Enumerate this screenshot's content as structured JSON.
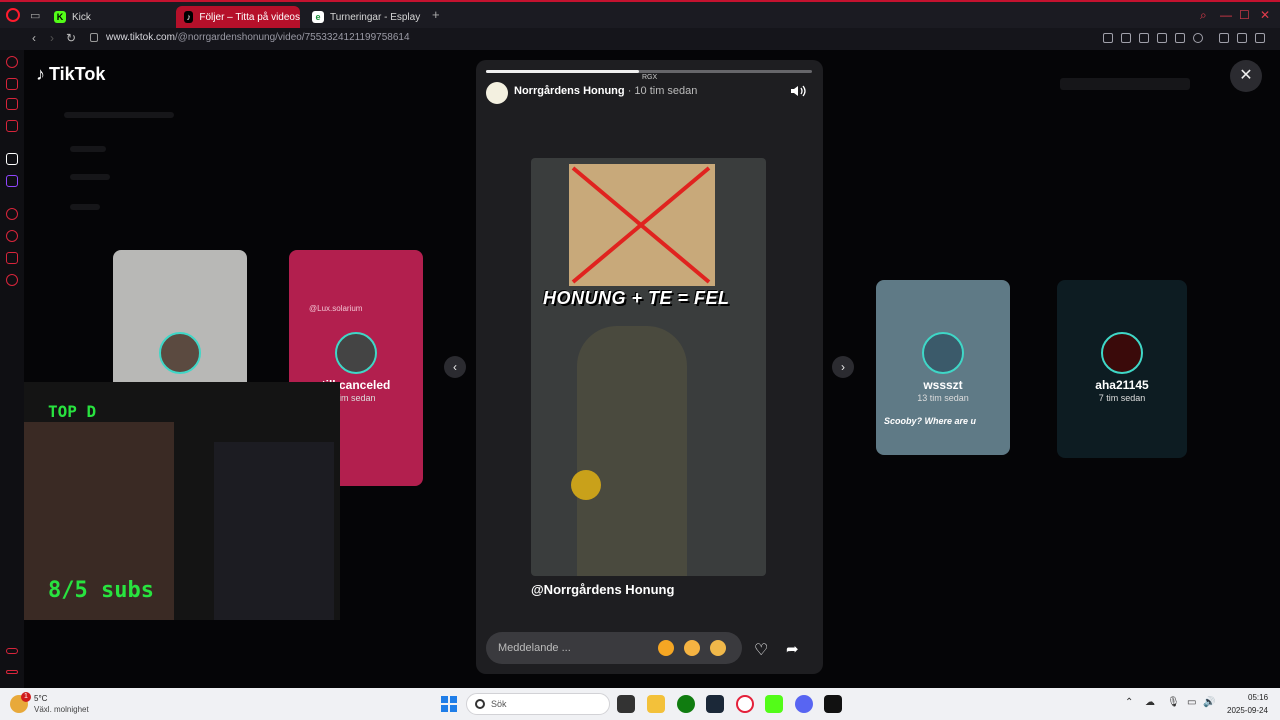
{
  "browser": {
    "tabs": [
      {
        "label": "Kick",
        "favicon": "K",
        "active": false
      },
      {
        "label": "Följer – Titta på videos",
        "favicon": "♪",
        "active": true
      },
      {
        "label": "Turneringar - Esplay",
        "favicon": "e",
        "active": false
      }
    ],
    "url_domain": "www.tiktok.com",
    "url_path": "/@norrgardenshonung/video/7553324121199758614"
  },
  "page": {
    "logo_text": "TikTok"
  },
  "side_cards": [
    {
      "name": "",
      "time": ""
    },
    {
      "name": "till.canceled",
      "time": "tim sedan",
      "watermark": "@Lux.solarium"
    },
    {
      "name": "wssszt",
      "time": "13 tim sedan",
      "overlay_text": "Scooby? Where are u"
    },
    {
      "name": "aha21145",
      "time": "7 tim sedan"
    }
  ],
  "stream_overlay": {
    "title": "TOP D",
    "subs": "8/5 subs"
  },
  "story": {
    "progress": 0.47,
    "segment_label": "RGX",
    "author": "Norrgårdens Honung",
    "time": "· 10 tim sedan",
    "video_caption": "HONUNG + TE = FEL",
    "handle": "@Norrgårdens Honung",
    "message_placeholder": "Meddelande ..."
  },
  "taskbar": {
    "weather_badge": "1",
    "temperature": "5°C",
    "weather": "Växl. molnighet",
    "search_placeholder": "Sök",
    "time": "05:16",
    "date": "2025-09-24"
  },
  "colors": {
    "accent": "#c4122f",
    "tiktok_cyan": "#3fd7c7",
    "stream_green": "#28e33f"
  }
}
